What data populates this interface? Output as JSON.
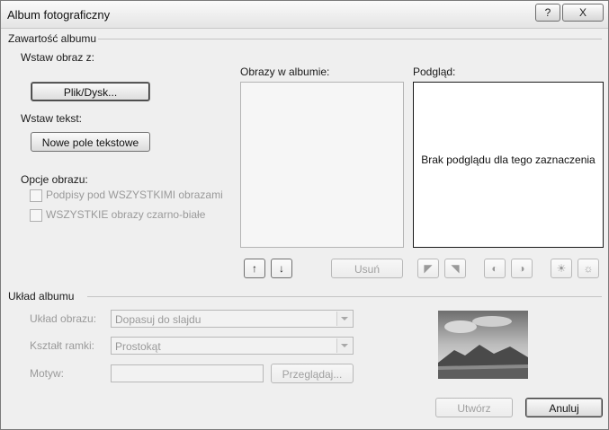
{
  "titlebar": {
    "title": "Album fotograficzny",
    "help_label": "?",
    "close_label": "X"
  },
  "album_content": {
    "group_label": "Zawartość albumu",
    "insert_picture": {
      "label": "Wstaw obraz z:",
      "button_label": "Plik/Dysk..."
    },
    "insert_text": {
      "label": "Wstaw tekst:",
      "button_label": "Nowe pole tekstowe"
    },
    "picture_options": {
      "label": "Opcje obrazu:",
      "captions_label": "Podpisy pod WSZYSTKIMI obrazami",
      "bw_label": "WSZYSTKIE obrazy czarno-białe"
    },
    "pictures_in_album": {
      "label": "Obrazy w albumie:",
      "remove_label": "Usuń",
      "move_up_icon": "arrow-up-icon",
      "move_down_icon": "arrow-down-icon"
    },
    "preview": {
      "label": "Podgląd:",
      "empty_text": "Brak podglądu dla tego zaznaczenia"
    }
  },
  "album_layout": {
    "group_label": "Układ albumu",
    "picture_layout": {
      "label": "Układ obrazu:",
      "value": "Dopasuj do slajdu"
    },
    "frame_shape": {
      "label": "Kształt ramki:",
      "value": "Prostokąt"
    },
    "theme": {
      "label": "Motyw:",
      "value": "",
      "browse_label": "Przeglądaj..."
    }
  },
  "footer": {
    "create_label": "Utwórz",
    "cancel_label": "Anuluj"
  },
  "colors": {
    "dialog_bg": "#efefef",
    "preview_border": "#1a1a1a",
    "disabled_text": "#9a9a9a"
  }
}
